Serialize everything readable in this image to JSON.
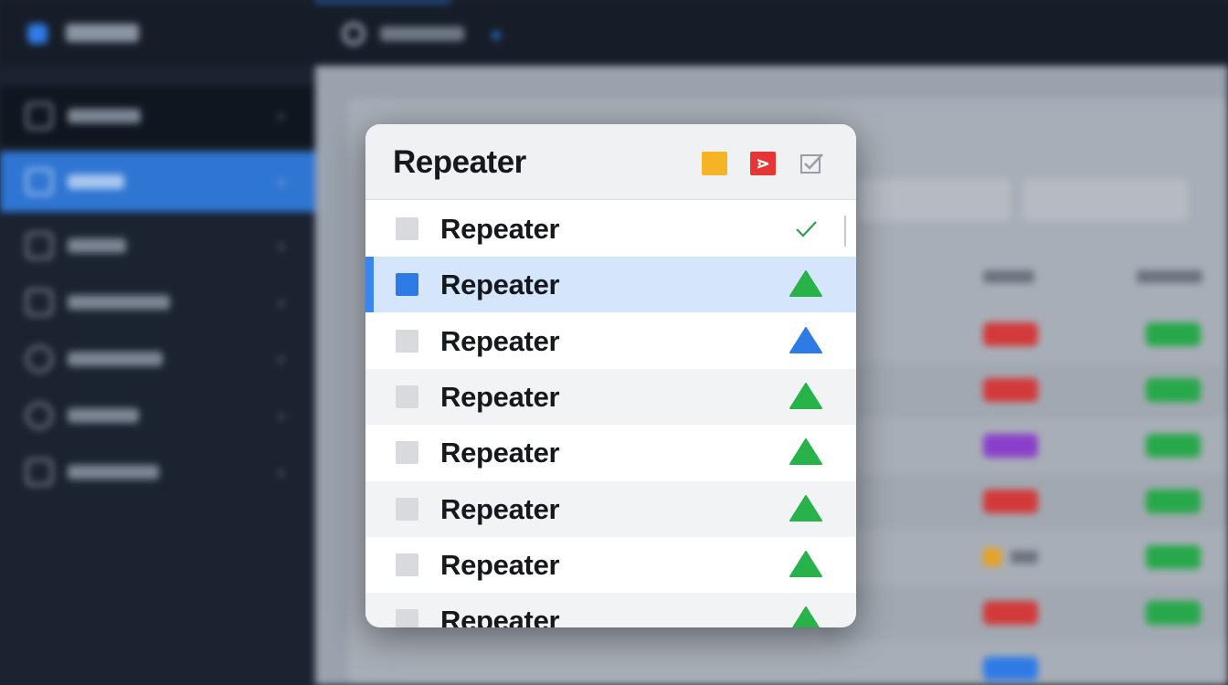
{
  "panel": {
    "title": "Repeater",
    "header_buttons": [
      {
        "name": "yellow-square-button",
        "color": "#f5b326"
      },
      {
        "name": "collapse-button",
        "color": "#e53535",
        "glyph": "⋗"
      },
      {
        "name": "checkbox-toggle-button",
        "icon": "check-square-icon"
      }
    ]
  },
  "rows": [
    {
      "label": "Repeater",
      "status": "check",
      "selected": false
    },
    {
      "label": "Repeater",
      "status": "green-triangle",
      "selected": true
    },
    {
      "label": "Repeater",
      "status": "blue-triangle",
      "selected": false
    },
    {
      "label": "Repeater",
      "status": "green-triangle",
      "selected": false
    },
    {
      "label": "Repeater",
      "status": "green-triangle",
      "selected": false
    },
    {
      "label": "Repeater",
      "status": "green-triangle",
      "selected": false
    },
    {
      "label": "Repeater",
      "status": "green-triangle",
      "selected": false
    },
    {
      "label": "Repeater",
      "status": "green-triangle",
      "selected": false
    }
  ],
  "colors": {
    "accent": "#2f7be6",
    "green": "#27b24a",
    "blue": "#2f7be6",
    "sidebar_active": "#2f75d2",
    "chip_red": "#d23a3a",
    "chip_purple": "#8b3fc9",
    "chip_green": "#27a84a",
    "chip_orange": "#e8a224",
    "chip_blue": "#2f7be6"
  },
  "background_table": {
    "status_chips": [
      "red",
      "red",
      "purple",
      "red",
      "orange-square",
      "red",
      "blue"
    ]
  }
}
